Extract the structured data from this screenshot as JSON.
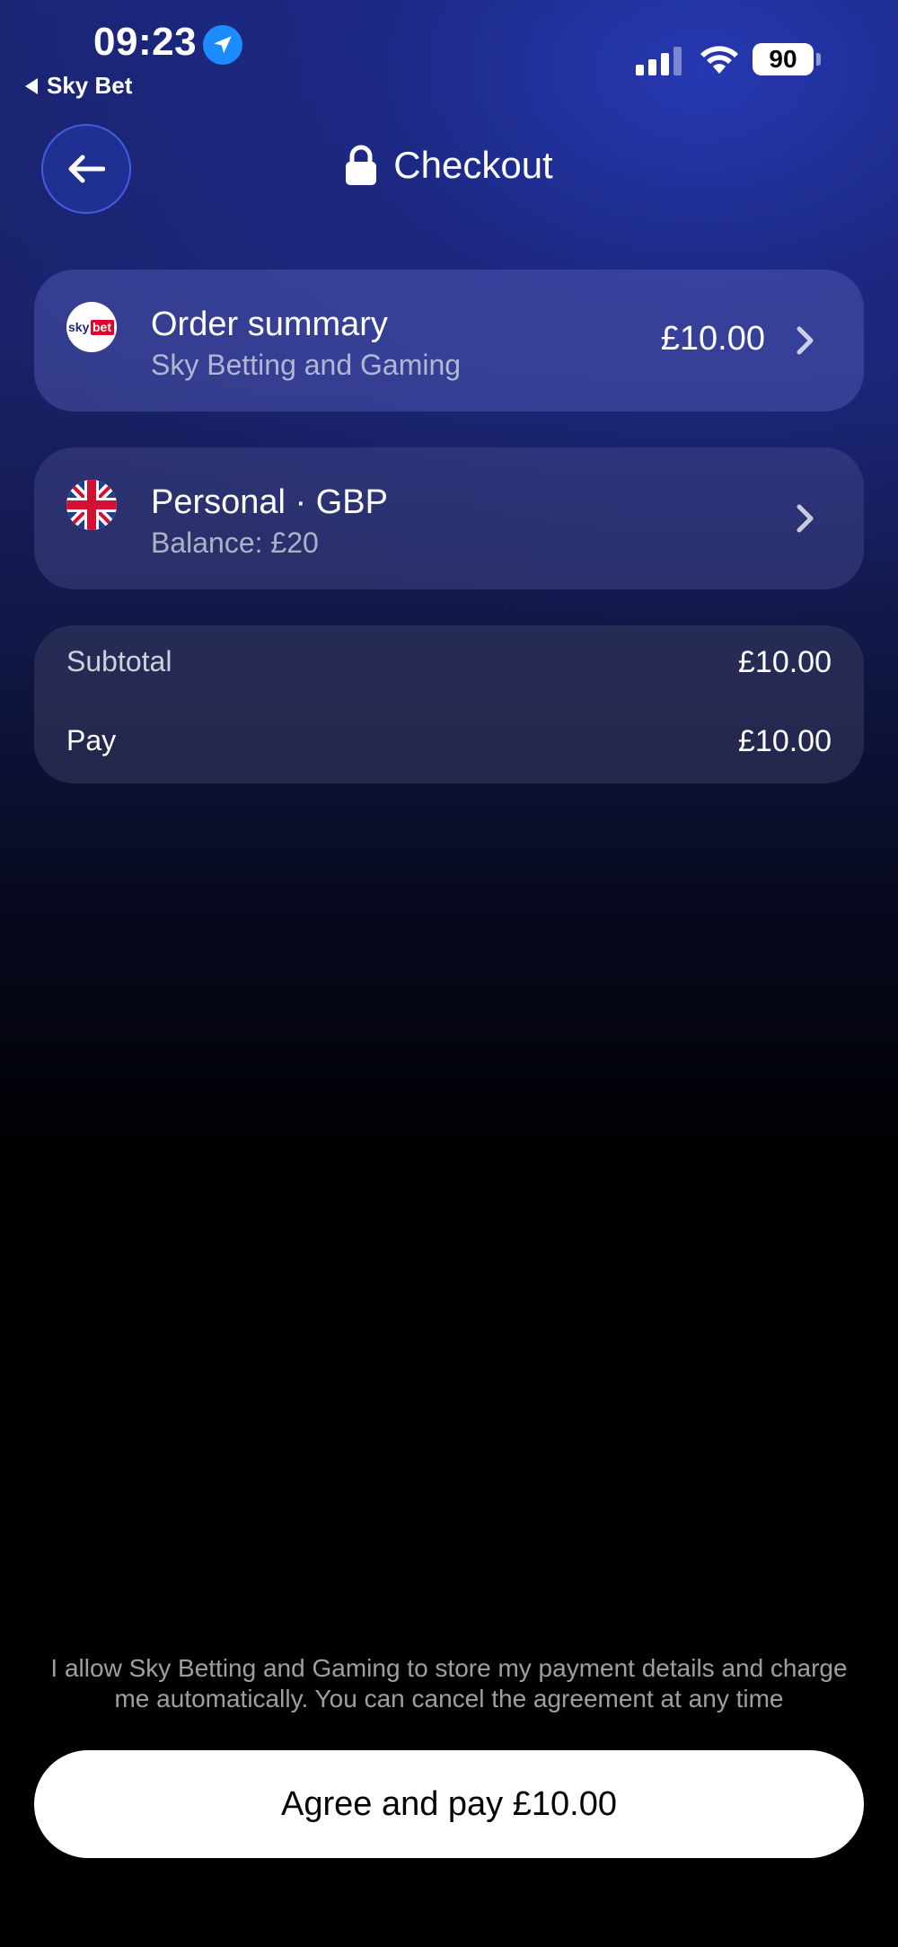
{
  "status_bar": {
    "time": "09:23",
    "back_app": "Sky Bet",
    "battery": "90"
  },
  "header": {
    "title": "Checkout"
  },
  "order_card": {
    "logo_text_1": "sky",
    "logo_text_2": "bet",
    "title": "Order summary",
    "subtitle": "Sky Betting and Gaming",
    "amount": "£10.00"
  },
  "account_card": {
    "title": "Personal · GBP",
    "subtitle": "Balance: £20"
  },
  "summary": {
    "subtotal_label": "Subtotal",
    "subtotal_value": "£10.00",
    "pay_label": "Pay",
    "pay_value": "£10.00"
  },
  "legal_text": "I allow Sky Betting and Gaming to store my payment details and charge me automatically. You can cancel the agreement at any time",
  "pay_button": "Agree and pay £10.00",
  "colors": {
    "accent_blue": "#1a8cff",
    "skybet_red": "#e4002b",
    "skybet_navy": "#1b2a7a"
  }
}
